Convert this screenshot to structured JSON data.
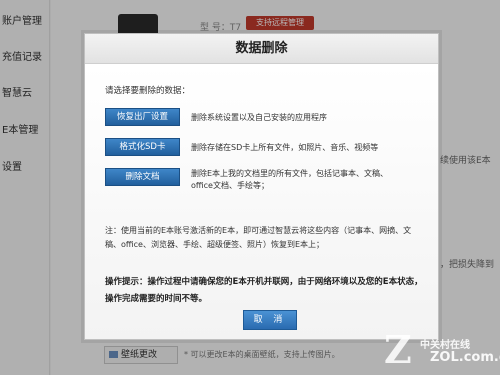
{
  "sidebar": {
    "items": [
      {
        "label": "账户管理"
      },
      {
        "label": "充值记录"
      },
      {
        "label": "智慧云"
      },
      {
        "label": "E本管理"
      },
      {
        "label": "设置"
      }
    ]
  },
  "background": {
    "device_model": "型    号：T7",
    "remote_badge": "支持远程管理",
    "hint_1": "续使用该E本",
    "hint_2": "，把损失降到",
    "wallpaper_button": "壁纸更改",
    "wallpaper_hint": "* 可以更改E本的桌面壁纸，支持上传图片。"
  },
  "watermark": {
    "brand": "中关村在线",
    "domain": "ZOL.com.cn"
  },
  "dialog": {
    "title": "数据删除",
    "prompt": "请选择要删除的数据：",
    "actions": [
      {
        "button": "恢复出厂设置",
        "description": "删除系统设置以及自己安装的应用程序"
      },
      {
        "button": "格式化SD卡",
        "description": "删除存储在SD卡上所有文件，如照片、音乐、视频等"
      },
      {
        "button": "删除文档",
        "description": "删除E本上我的文档里的所有文件，包括记事本、文稿、office文档、手绘等；"
      }
    ],
    "note": "注：使用当前的E本账号激活新的E本，即可通过智慧云将这些内容（记事本、网摘、文稿、office、浏览器、手绘、超级便签、照片）恢复到E本上；",
    "tips": "操作提示：操作过程中请确保您的E本开机并联网，由于网络环境以及您的E本状态，操作完成需要的时间不等。",
    "cancel_label": "取 消"
  }
}
